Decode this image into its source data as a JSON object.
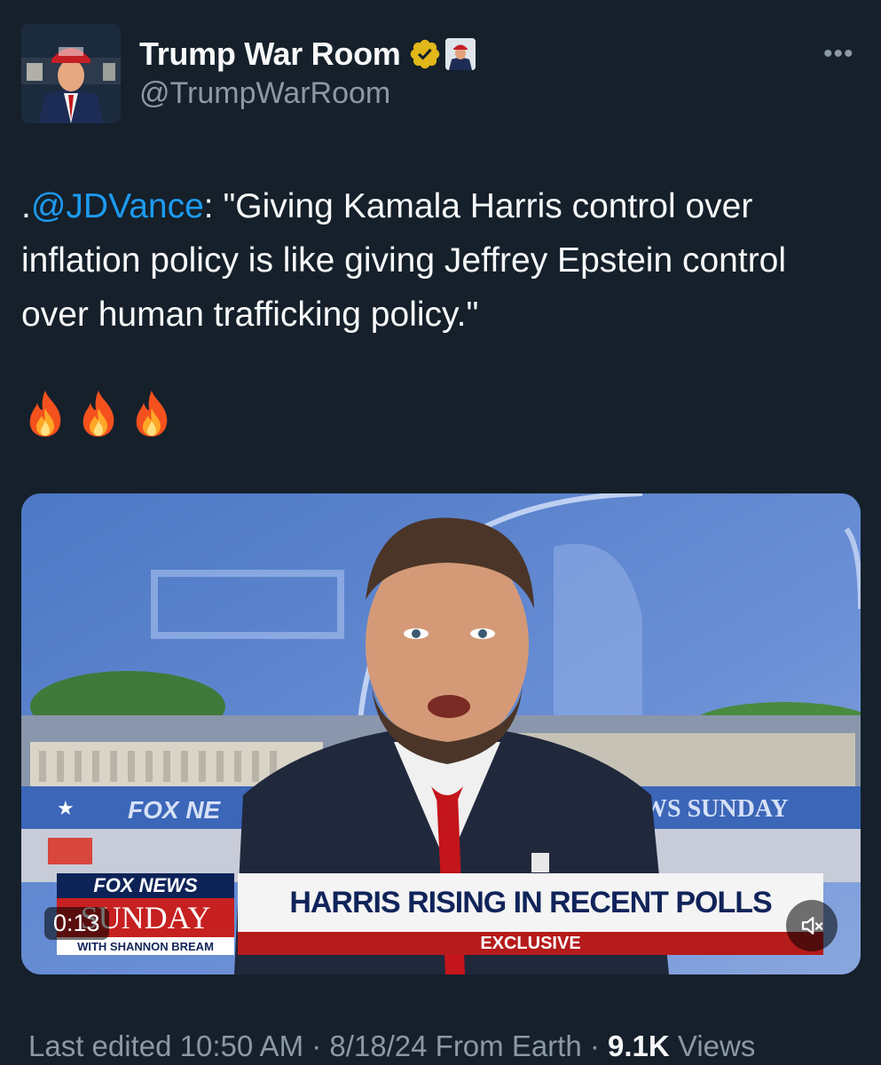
{
  "account": {
    "display_name": "Trump War Room",
    "handle": "@TrumpWarRoom",
    "verified": "gold-verified-badge",
    "more_icon": "more-icon"
  },
  "tweet": {
    "prefix": ".",
    "mention": "@JDVance",
    "quote": ": \"Giving Kamala Harris control over inflation policy is like giving Jeffrey Epstein control over human trafficking policy.\"",
    "emoji": [
      "fire-icon",
      "fire-icon",
      "fire-icon"
    ]
  },
  "video": {
    "duration": "0:13",
    "mute_icon": "mute-icon",
    "chyron_headline": "HARRIS RISING IN RECENT POLLS",
    "chyron_sub": "EXCLUSIVE",
    "network_top": "FOX NEWS",
    "network_show": "SUNDAY",
    "network_host": "WITH SHANNON BREAM",
    "backdrop_text_left": "FOX NE",
    "backdrop_text_right": "WS SUNDAY"
  },
  "meta": {
    "edited": "Last edited 10:50 AM · 8/18/24",
    "source": "From Earth ·",
    "views_count": "9.1K",
    "views_label": "Views"
  },
  "colors": {
    "background": "#15202b",
    "text": "#f7f9f9",
    "secondary": "#8b98a5",
    "link": "#1d9bf0",
    "verified_gold": "#e2b719"
  }
}
